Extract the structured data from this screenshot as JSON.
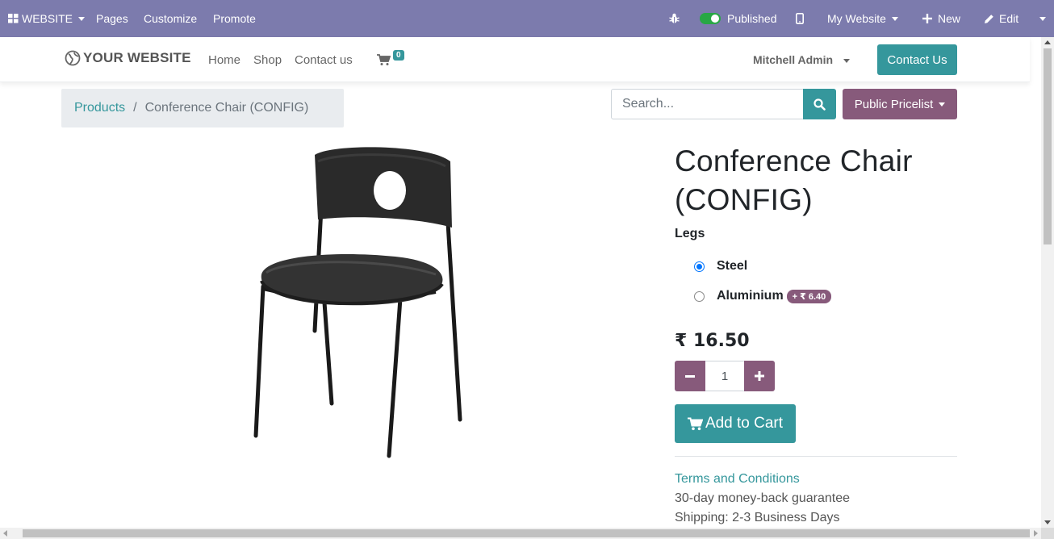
{
  "admin_bar": {
    "app_menu_label": "WEBSITE",
    "pages_label": "Pages",
    "customize_label": "Customize",
    "promote_label": "Promote",
    "published_label": "Published",
    "website_selector_label": "My Website",
    "new_label": "New",
    "edit_label": "Edit",
    "bg_color": "#7c7bad"
  },
  "header": {
    "logo_text": "YOUR WEBSITE",
    "nav": [
      "Home",
      "Shop",
      "Contact us"
    ],
    "cart_count": "0",
    "user_name": "Mitchell Admin",
    "contact_button": "Contact Us"
  },
  "breadcrumb": {
    "parent": "Products",
    "separator": "/",
    "current": "Conference Chair (CONFIG)"
  },
  "search": {
    "placeholder": "Search..."
  },
  "pricelist": {
    "label": "Public Pricelist"
  },
  "product": {
    "title_line1": "Conference Chair",
    "title_line2": "(CONFIG)",
    "attribute_label": "Legs",
    "options": [
      {
        "label": "Steel",
        "selected": true,
        "extra": ""
      },
      {
        "label": "Aluminium",
        "selected": false,
        "extra": "+ ₹ 6.40"
      }
    ],
    "price": "₹ 16.50",
    "quantity": "1",
    "add_to_cart_label": "Add to Cart",
    "terms_link": "Terms and Conditions",
    "guarantee": "30-day money-back guarantee",
    "shipping": "Shipping: 2-3 Business Days"
  },
  "colors": {
    "primary": "#35979c",
    "secondary": "#875a7b"
  }
}
